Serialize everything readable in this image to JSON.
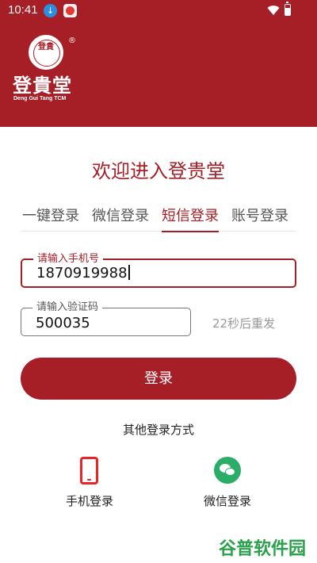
{
  "status_bar": {
    "time": "10:41",
    "icons": [
      "download-icon",
      "app-notification-icon",
      "wifi-icon",
      "battery-icon"
    ]
  },
  "logo": {
    "seal_text": "登貴",
    "registered": "®",
    "name_cn": "登貴堂",
    "name_en": "Deng Gui Tang  TCM"
  },
  "title": "欢迎进入登贵堂",
  "tabs": [
    {
      "label": "一键登录",
      "active": false
    },
    {
      "label": "微信登录",
      "active": false
    },
    {
      "label": "短信登录",
      "active": true
    },
    {
      "label": "账号登录",
      "active": false
    }
  ],
  "phone_field": {
    "label": "请输入手机号",
    "value": "1870919988"
  },
  "code_field": {
    "label": "请输入验证码",
    "value": "500035"
  },
  "resend_label": "22秒后重发",
  "login_button": "登录",
  "other_methods": {
    "title": "其他登录方式",
    "items": [
      {
        "label": "手机登录",
        "icon": "mobile-phone-icon"
      },
      {
        "label": "微信登录",
        "icon": "wechat-icon"
      }
    ]
  },
  "watermark": "谷普软件园",
  "colors": {
    "brand": "#a61e26",
    "phone_icon": "#e8262a",
    "wechat": "#2aae67"
  }
}
